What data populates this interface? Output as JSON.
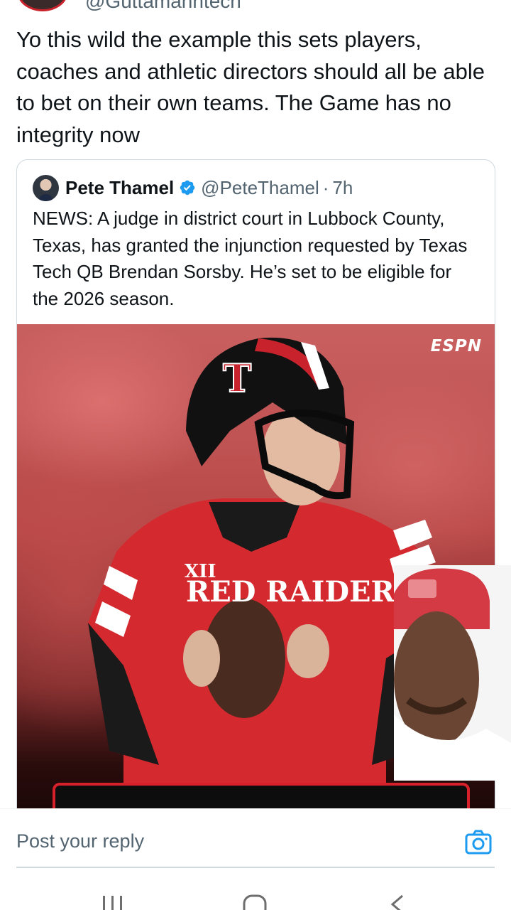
{
  "tweet": {
    "handle_cropped": "@Guttamanntech",
    "text": "Yo this wild the example this sets players, coaches and athletic directors should all be able to bet on their own teams. The Game has no integrity now"
  },
  "quoted_tweet": {
    "author_name": "Pete Thamel",
    "verified_icon": "verified-badge-icon",
    "handle": "@PeteThamel",
    "separator": "·",
    "time": "7h",
    "text": "NEWS: A judge in district court in Lubbock County, Texas, has granted the injunction requested by Texas Tech QB Brendan Sorsby. He’s set to be eligible for the 2026 season.",
    "media": {
      "logo": "ESPN",
      "jersey_text": "RED RAIDERS"
    }
  },
  "reply": {
    "placeholder": "Post your reply",
    "camera_icon": "camera-icon"
  },
  "system_nav": {
    "recents_icon": "recents-icon",
    "home_icon": "home-icon",
    "back_icon": "back-icon"
  },
  "colors": {
    "accent": "#1d9bf0",
    "text_primary": "#0f1419",
    "text_secondary": "#536471",
    "border": "#cfd9de",
    "team_red": "#d6202a"
  }
}
